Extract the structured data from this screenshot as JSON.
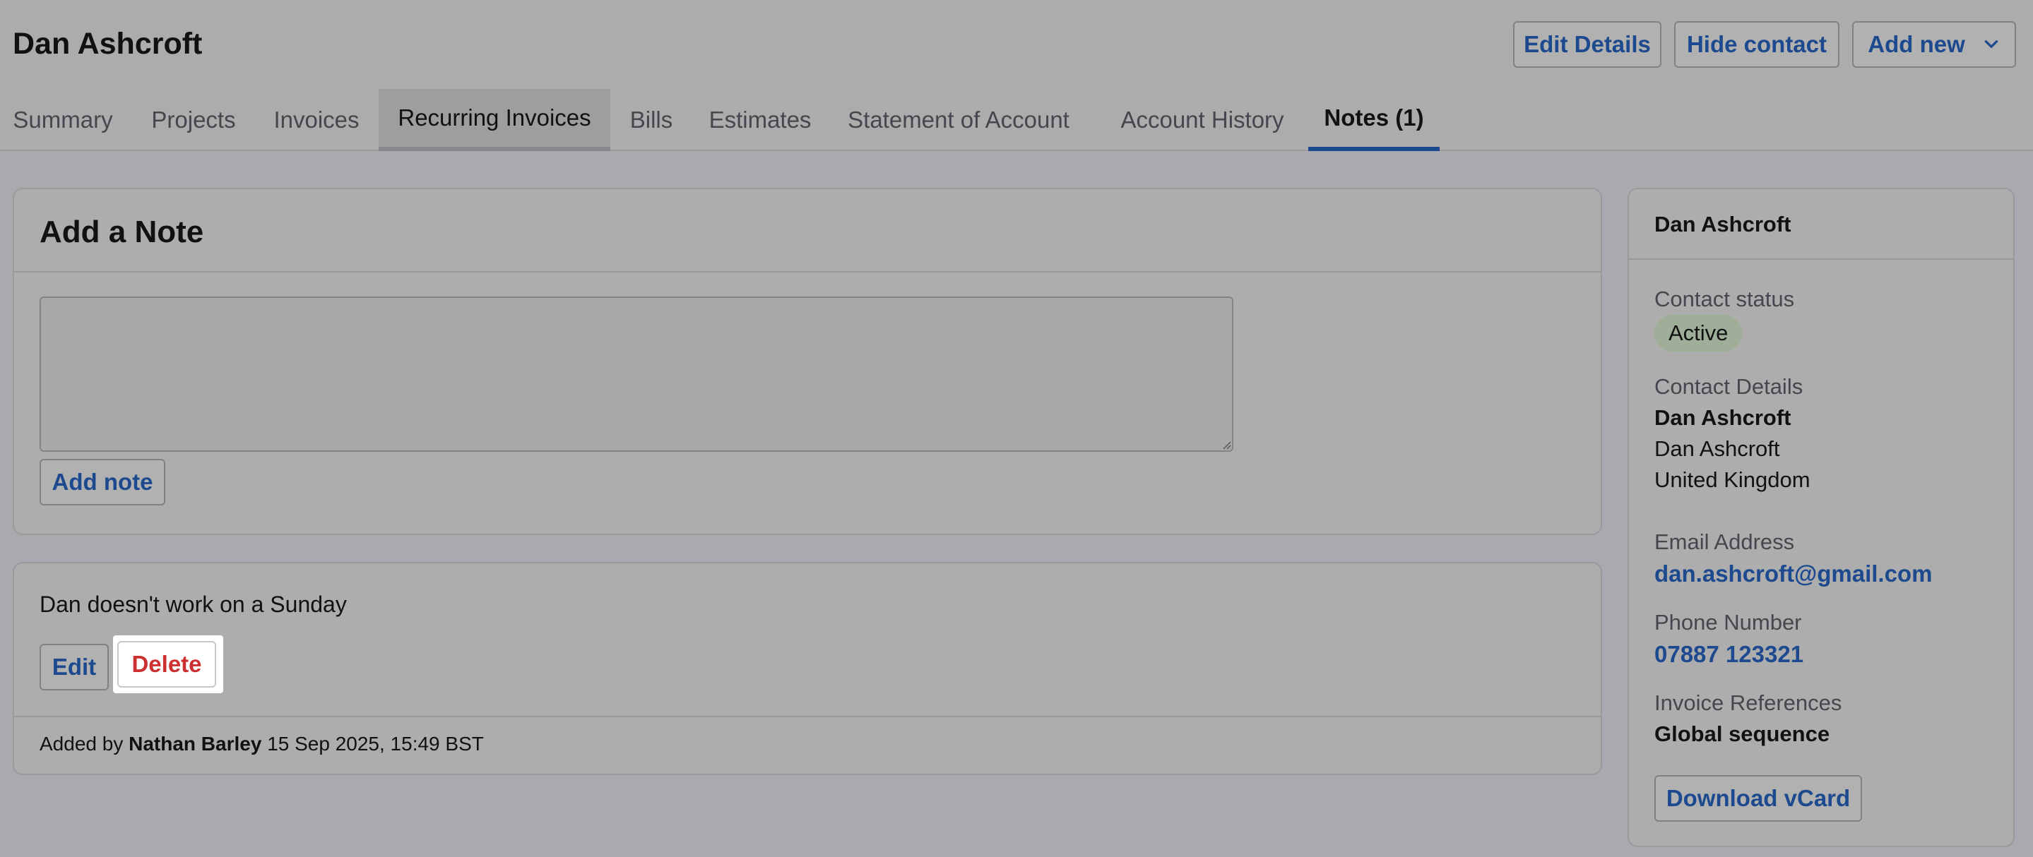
{
  "header": {
    "title": "Dan Ashcroft",
    "buttons": {
      "edit_details": "Edit Details",
      "hide_contact": "Hide contact",
      "add_new": "Add new"
    }
  },
  "tabs": [
    {
      "label": "Summary"
    },
    {
      "label": "Projects"
    },
    {
      "label": "Invoices"
    },
    {
      "label": "Recurring Invoices"
    },
    {
      "label": "Bills"
    },
    {
      "label": "Estimates"
    },
    {
      "label": "Statement of Account"
    },
    {
      "label": "Account History"
    },
    {
      "label": "Notes (1)"
    }
  ],
  "add_note": {
    "title": "Add a Note",
    "textarea_value": "",
    "button_label": "Add note"
  },
  "note": {
    "text": "Dan doesn't work on a Sunday",
    "edit_label": "Edit",
    "delete_label": "Delete",
    "added_by_prefix": "Added by",
    "author": "Nathan Barley",
    "timestamp": "15 Sep 2025, 15:49 BST"
  },
  "sidebar": {
    "name": "Dan Ashcroft",
    "contact_status_label": "Contact status",
    "contact_status": "Active",
    "contact_details_label": "Contact Details",
    "details_line1": "Dan Ashcroft",
    "details_line2": "Dan Ashcroft",
    "details_line3": "United Kingdom",
    "email_label": "Email Address",
    "email": "dan.ashcroft@gmail.com",
    "phone_label": "Phone Number",
    "phone": "07887 123321",
    "invoice_ref_label": "Invoice References",
    "invoice_ref": "Global sequence",
    "download_vcard": "Download vCard"
  },
  "colors": {
    "link_blue": "#1d4a8e",
    "delete_red": "#cc3030",
    "active_badge": "#9fae98"
  }
}
